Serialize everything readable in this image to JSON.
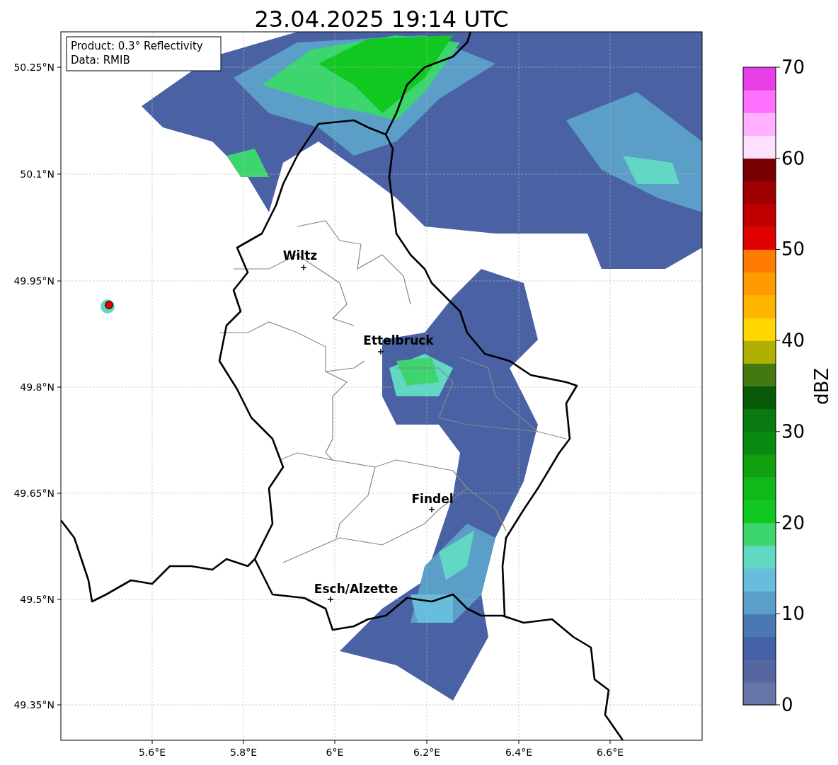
{
  "title": "23.04.2025 19:14 UTC",
  "legend": [
    "Product: 0.3° Reflectivity",
    "Data: RMIB"
  ],
  "map": {
    "x_ticks": [
      "5.6°E",
      "5.8°E",
      "6°E",
      "6.2°E",
      "6.4°E",
      "6.6°E"
    ],
    "y_ticks": [
      "50.25°N",
      "50.1°N",
      "49.95°N",
      "49.8°N",
      "49.65°N",
      "49.5°N",
      "49.35°N"
    ],
    "places": [
      {
        "name": "Wiltz"
      },
      {
        "name": "Ettelbruck"
      },
      {
        "name": "Findel"
      },
      {
        "name": "Esch/Alzette"
      }
    ]
  },
  "colorbar": {
    "label": "dBZ",
    "ticks": [
      "70",
      "60",
      "50",
      "40",
      "30",
      "20",
      "10",
      "0"
    ],
    "bins": [
      {
        "color": "#6674a8"
      },
      {
        "color": "#5566a0"
      },
      {
        "color": "#4460a8"
      },
      {
        "color": "#4a78b0"
      },
      {
        "color": "#5b9ec8"
      },
      {
        "color": "#66bedc"
      },
      {
        "color": "#60d8c4"
      },
      {
        "color": "#3dd66e"
      },
      {
        "color": "#10c820"
      },
      {
        "color": "#10b818"
      },
      {
        "color": "#10a010"
      },
      {
        "color": "#0a8a10"
      },
      {
        "color": "#087a10"
      },
      {
        "color": "#085a08"
      },
      {
        "color": "#447810"
      },
      {
        "color": "#b0b000"
      },
      {
        "color": "#ffd700"
      },
      {
        "color": "#ffb400"
      },
      {
        "color": "#ff9a00"
      },
      {
        "color": "#ff7c00"
      },
      {
        "color": "#e00000"
      },
      {
        "color": "#c00000"
      },
      {
        "color": "#a00000"
      },
      {
        "color": "#780000"
      },
      {
        "color": "#ffe0ff"
      },
      {
        "color": "#ffb0ff"
      },
      {
        "color": "#ff70ff"
      },
      {
        "color": "#e840e8"
      }
    ]
  }
}
